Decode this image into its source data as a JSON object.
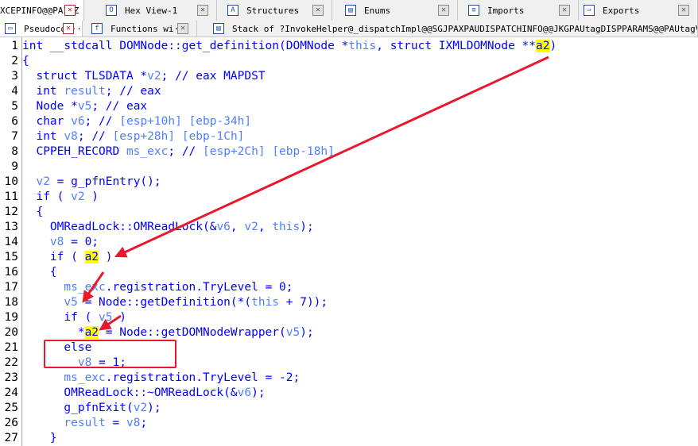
{
  "tabs_row1": [
    {
      "label": "XCEPINFO@@PAI@Z",
      "icon": "function-icon",
      "close": "close-icon-red",
      "active": true
    },
    {
      "label": "Hex View-1",
      "icon": "hex-view-icon",
      "close": "close-icon"
    },
    {
      "label": "Structures",
      "icon": "structures-icon",
      "close": "close-icon"
    },
    {
      "label": "Enums",
      "icon": "enums-icon",
      "close": "close-icon"
    },
    {
      "label": "Imports",
      "icon": "imports-icon",
      "close": "close-icon"
    },
    {
      "label": "Exports",
      "icon": "exports-icon",
      "close": "close-icon"
    }
  ],
  "tabs_row2": [
    {
      "label": "Pseudoco···",
      "icon": "pseudocode-icon",
      "close": "close-icon-red",
      "active": true
    },
    {
      "label": "Functions wi···",
      "icon": "functions-icon",
      "close": "close-icon"
    },
    {
      "label": "Stack of ?InvokeHelper@_dispatchImpl@@SGJPAXPAUDISPATCHINFO@@JKGPAUtagDISPPARAMS@@PAUtagVARIANT@@PAUtagEXCEPINFO@@PAI@Z",
      "icon": "stack-icon"
    }
  ],
  "code_lines": [
    {
      "n": "1",
      "t": "int __stdcall DOMNode::get_definition(DOMNode *this, struct IXMLDOMNode **a2)"
    },
    {
      "n": "2",
      "t": "{"
    },
    {
      "n": "3",
      "t": "  struct TLSDATA *v2; // eax MAPDST"
    },
    {
      "n": "4",
      "t": "  int result; // eax"
    },
    {
      "n": "5",
      "t": "  Node *v5; // eax"
    },
    {
      "n": "6",
      "t": "  char v6; // [esp+10h] [ebp-34h]"
    },
    {
      "n": "7",
      "t": "  int v8; // [esp+28h] [ebp-1Ch]"
    },
    {
      "n": "8",
      "t": "  CPPEH_RECORD ms_exc; // [esp+2Ch] [ebp-18h]"
    },
    {
      "n": "9",
      "t": ""
    },
    {
      "n": "10",
      "t": "  v2 = g_pfnEntry();"
    },
    {
      "n": "11",
      "t": "  if ( v2 )"
    },
    {
      "n": "12",
      "t": "  {"
    },
    {
      "n": "13",
      "t": "    OMReadLock::OMReadLock(&v6, v2, this);"
    },
    {
      "n": "14",
      "t": "    v8 = 0;"
    },
    {
      "n": "15",
      "t": "    if ( a2 )"
    },
    {
      "n": "16",
      "t": "    {"
    },
    {
      "n": "17",
      "t": "      ms_exc.registration.TryLevel = 0;"
    },
    {
      "n": "18",
      "t": "      v5 = Node::getDefinition(*(this + 7));"
    },
    {
      "n": "19",
      "t": "      if ( v5 )"
    },
    {
      "n": "20",
      "t": "        *a2 = Node::getDOMNodeWrapper(v5);"
    },
    {
      "n": "21",
      "t": "      else"
    },
    {
      "n": "22",
      "t": "        v8 = 1;"
    },
    {
      "n": "23",
      "t": "      ms_exc.registration.TryLevel = -2;"
    },
    {
      "n": "24",
      "t": "      OMReadLock::~OMReadLock(&v6);"
    },
    {
      "n": "25",
      "t": "      g_pfnExit(v2);"
    },
    {
      "n": "26",
      "t": "      result = v8;"
    },
    {
      "n": "27",
      "t": "    }"
    }
  ],
  "colors": {
    "code": "#0000ff",
    "variable": "#4f7fff",
    "highlight": "#ffff00",
    "annotation": "#e8192c"
  }
}
